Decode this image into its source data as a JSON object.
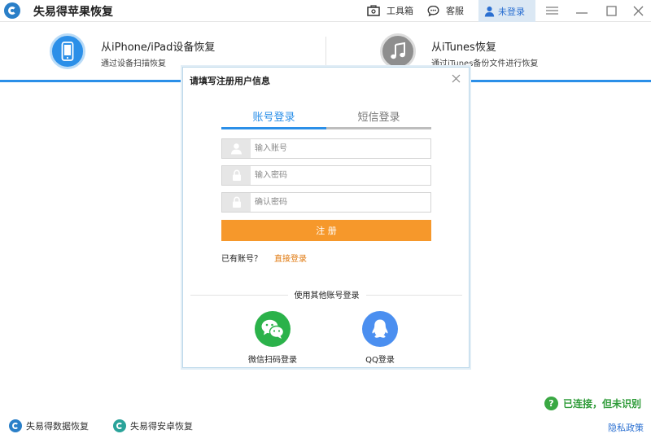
{
  "app": {
    "title": "失易得苹果恢复",
    "icon": "app-logo-icon"
  },
  "titlebar": {
    "toolbox_label": "工具箱",
    "service_label": "客服",
    "login_label": "未登录",
    "login_icon": "user-icon",
    "menu_icon": "menu-icon",
    "minimize_icon": "minimize-icon",
    "maximize_icon": "maximize-icon",
    "close_icon": "close-icon"
  },
  "modes": [
    {
      "title": "从iPhone/iPad设备恢复",
      "subtitle": "通过设备扫描恢复",
      "icon": "phone-icon",
      "active": true
    },
    {
      "title": "从iTunes恢复",
      "subtitle": "通过iTunes备份文件进行恢复",
      "icon": "music-note-icon",
      "active": false
    }
  ],
  "dialog": {
    "title": "请填写注册用户信息",
    "tabs": [
      {
        "label": "账号登录",
        "active": true
      },
      {
        "label": "短信登录",
        "active": false
      }
    ],
    "fields": {
      "account_placeholder": "输入账号",
      "password_placeholder": "输入密码",
      "confirm_placeholder": "确认密码"
    },
    "register_label": "注 册",
    "have_account": "已有账号？",
    "direct_login": "直接登录",
    "other_login": "使用其他账号登录",
    "wechat_label": "微信扫码登录",
    "qq_label": "QQ登录"
  },
  "status": {
    "text": "已连接，但未识别",
    "icon": "question-icon"
  },
  "footer": {
    "data_recovery": "失易得数据恢复",
    "android_recovery": "失易得安卓恢复",
    "privacy": "隐私政策"
  },
  "colors": {
    "accent": "#2b8fe8",
    "register": "#f6982b",
    "wechat": "#2bb24a",
    "qq": "#4b8ff0",
    "status": "#2e9b38",
    "link": "#e07a10"
  }
}
